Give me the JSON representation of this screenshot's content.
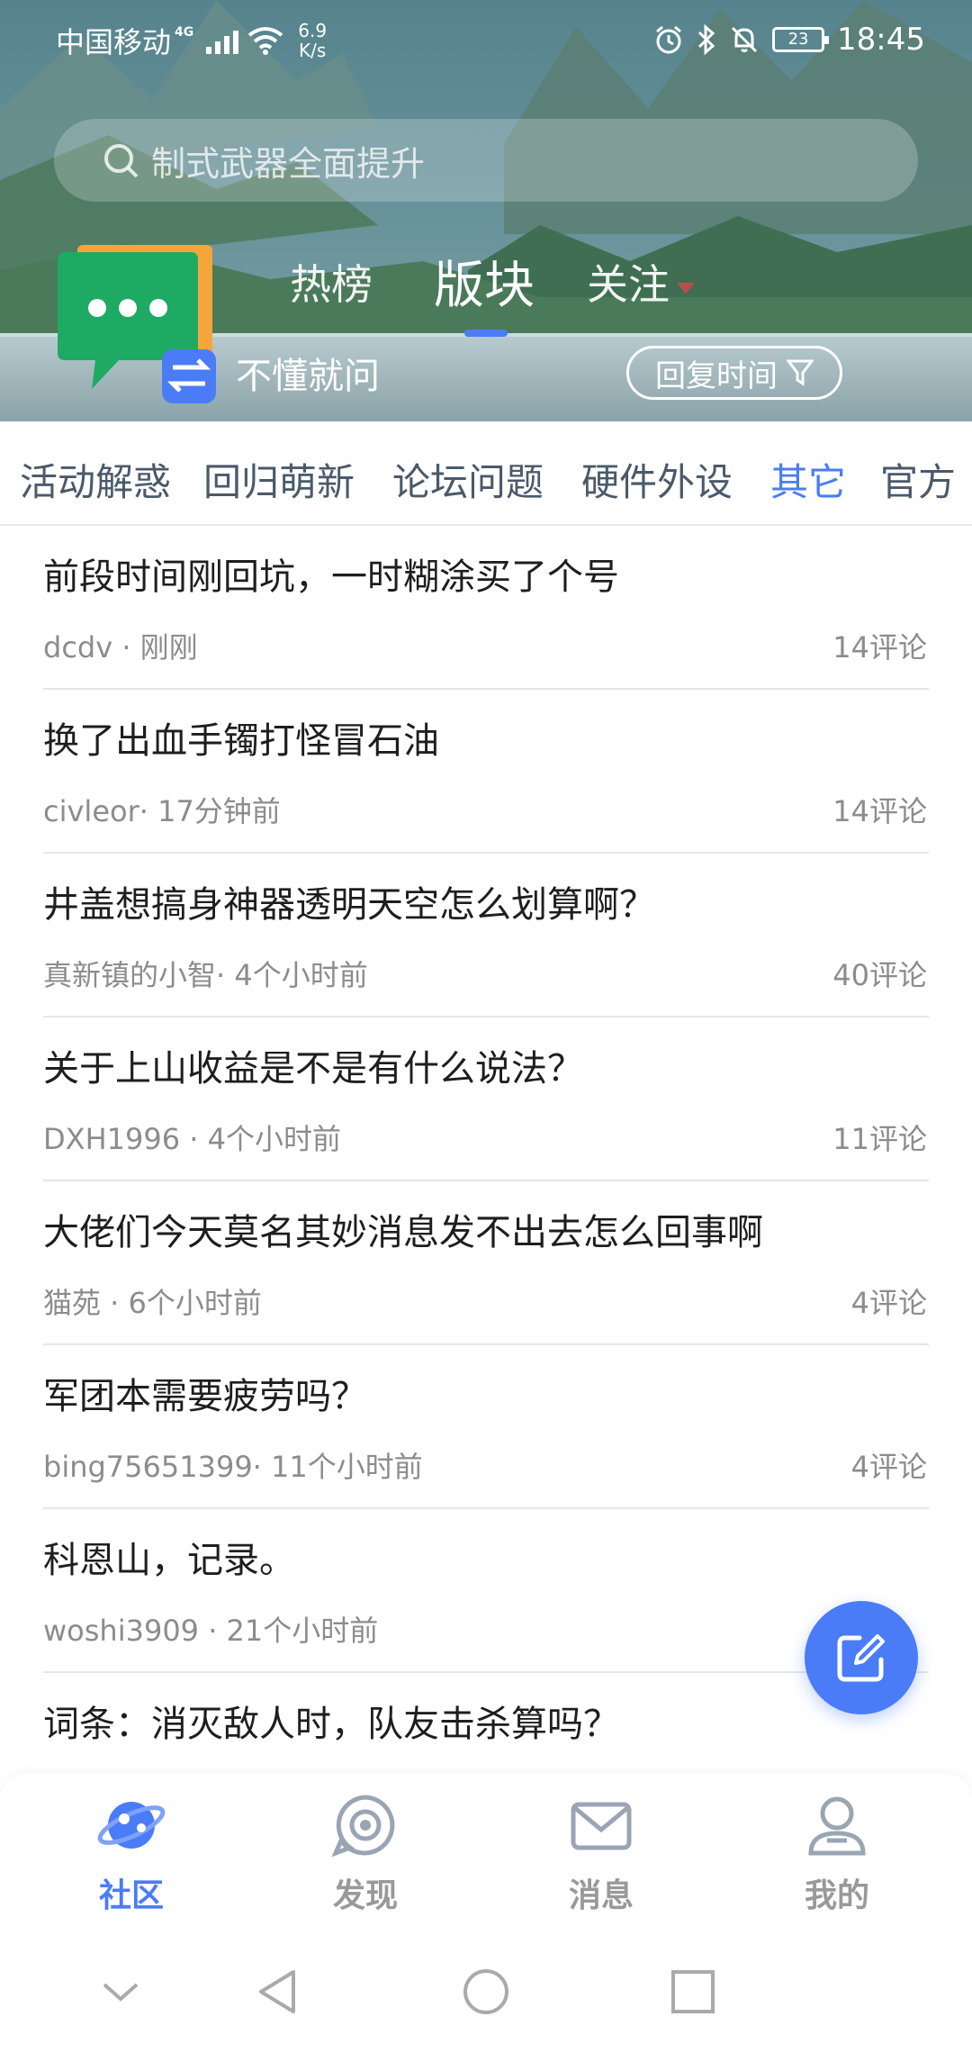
{
  "status_bar": {
    "carrier": "中国移动",
    "network": "4G",
    "speed_value": "6.9",
    "speed_unit": "K/s",
    "battery": "23",
    "time": "18:45"
  },
  "search": {
    "placeholder": "制式武器全面提升"
  },
  "top_tabs": [
    {
      "label": "热榜",
      "active": false
    },
    {
      "label": "版块",
      "active": true
    },
    {
      "label": "关注",
      "active": false
    }
  ],
  "section": {
    "label": "不懂就问",
    "sort_label": "回复时间"
  },
  "categories": [
    {
      "label": "活动解惑",
      "active": false
    },
    {
      "label": "回归萌新",
      "active": false
    },
    {
      "label": "论坛问题",
      "active": false
    },
    {
      "label": "硬件外设",
      "active": false
    },
    {
      "label": "其它",
      "active": true
    },
    {
      "label": "官方",
      "active": false
    }
  ],
  "posts": [
    {
      "title": "前段时间刚回坑，一时糊涂买了个号",
      "meta": "dcdv · 刚刚",
      "comments": "14评论"
    },
    {
      "title": "换了出血手镯打怪冒石油",
      "meta": "civleor· 17分钟前",
      "comments": "14评论"
    },
    {
      "title": "井盖想搞身神器透明天空怎么划算啊？",
      "meta": "真新镇的小智· 4个小时前",
      "comments": "40评论"
    },
    {
      "title": "关于上山收益是不是有什么说法？",
      "meta": "DXH1996  · 4个小时前",
      "comments": "11评论"
    },
    {
      "title": "大佬们今天莫名其妙消息发不出去怎么回事啊",
      "meta": "猫苑  · 6个小时前",
      "comments": "4评论"
    },
    {
      "title": "军团本需要疲劳吗？",
      "meta": "bing75651399· 11个小时前",
      "comments": "4评论"
    },
    {
      "title": "科恩山，记录。",
      "meta": "woshi3909  · 21个小时前",
      "comments": ""
    },
    {
      "title": "词条：消灭敌人时，队友击杀算吗？",
      "meta": "",
      "comments": ""
    }
  ],
  "bottom_nav": [
    {
      "label": "社区",
      "icon": "community-planet-icon",
      "active": true
    },
    {
      "label": "发现",
      "icon": "discover-target-icon",
      "active": false
    },
    {
      "label": "消息",
      "icon": "message-envelope-icon",
      "active": false
    },
    {
      "label": "我的",
      "icon": "profile-person-icon",
      "active": false
    }
  ],
  "colors": {
    "accent": "#4a7cf7",
    "logo_green": "#1faa63",
    "logo_orange": "#f6a53a"
  }
}
